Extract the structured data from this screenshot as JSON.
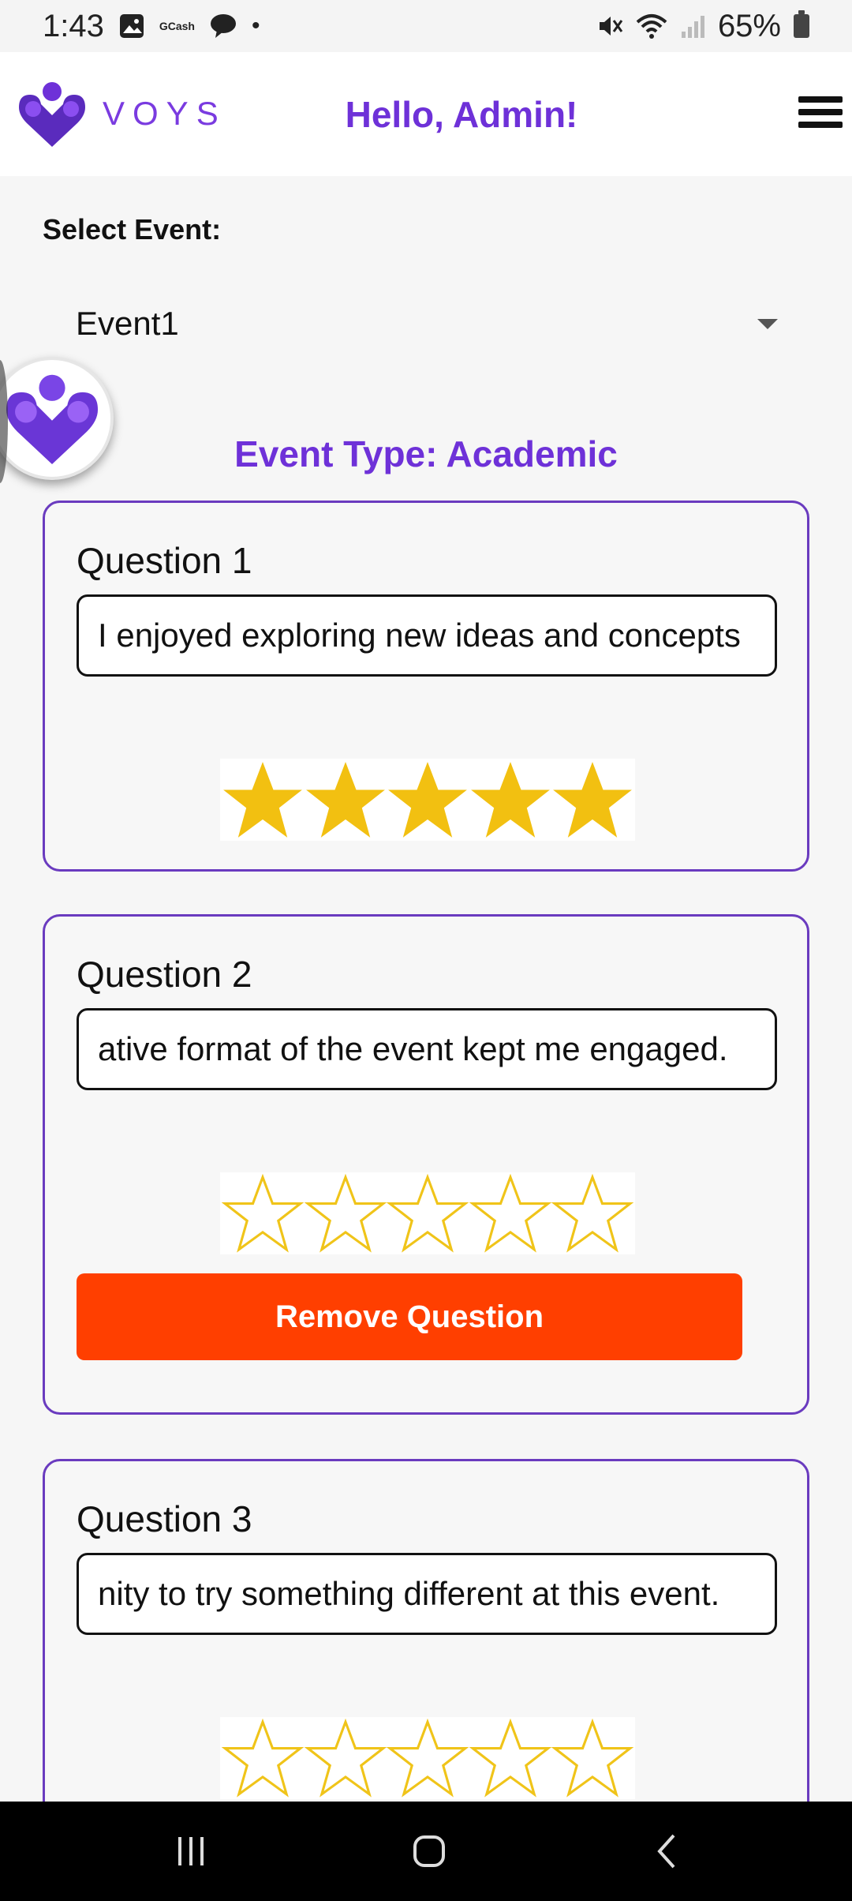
{
  "status_bar": {
    "time": "1:43",
    "gcash": "GCash",
    "dot": "•",
    "battery": "65%"
  },
  "header": {
    "logo_text": "VOYS",
    "greeting": "Hello, Admin!"
  },
  "event_select": {
    "label": "Select Event:",
    "value": "Event1"
  },
  "event_type": "Event Type: Academic",
  "questions": [
    {
      "title": "Question 1",
      "text": "I enjoyed exploring new ideas and concepts",
      "rating": 5
    },
    {
      "title": "Question 2",
      "text": "ative format of the event kept me engaged.",
      "rating": 0,
      "remove_label": "Remove Question"
    },
    {
      "title": "Question 3",
      "text": "nity to try something different at this event.",
      "rating": 0
    }
  ],
  "colors": {
    "accent": "#6e31d8",
    "remove_button": "#ff3f00",
    "star": "#f2c011"
  }
}
